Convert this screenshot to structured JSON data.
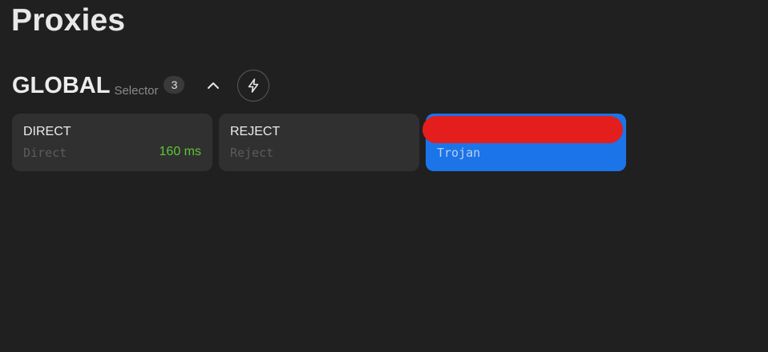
{
  "page": {
    "title": "Proxies"
  },
  "group": {
    "name": "GLOBAL",
    "type": "Selector",
    "count": "3",
    "collapse_icon": "chevron-up-icon",
    "speedtest_icon": "lightning-icon"
  },
  "proxies": [
    {
      "name": "DIRECT",
      "type": "Direct",
      "latency": "160 ms",
      "selected": false
    },
    {
      "name": "REJECT",
      "type": "Reject",
      "latency": "",
      "selected": false
    },
    {
      "name": "",
      "type": "Trojan",
      "latency": "",
      "selected": true,
      "name_redacted": true
    }
  ],
  "colors": {
    "background": "#202020",
    "card": "#303030",
    "selected_card": "#1b74e8",
    "latency_good": "#5fc436",
    "redaction": "#e41d1d"
  }
}
